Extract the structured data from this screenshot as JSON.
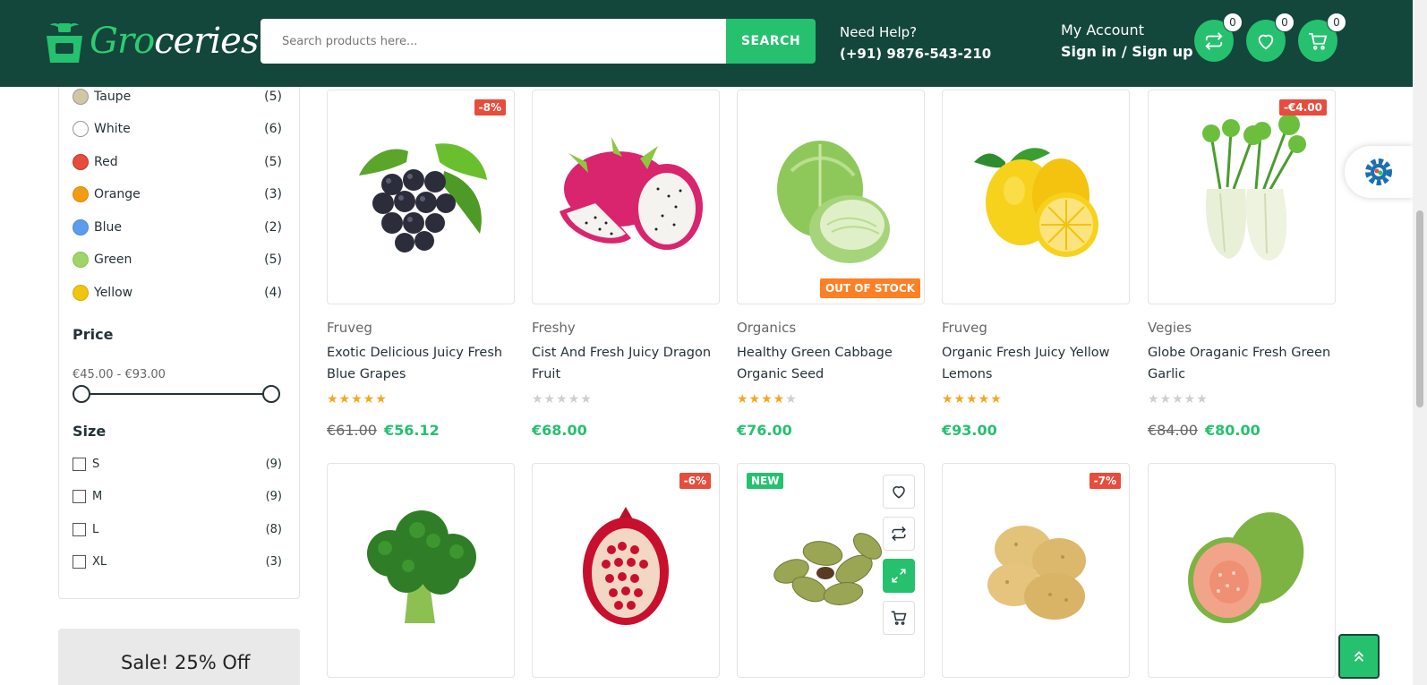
{
  "header": {
    "logo_text_a": "Gro",
    "logo_text_b": "ceries",
    "search_placeholder": "Search products here...",
    "search_button": "SEARCH",
    "help_title": "Need Help?",
    "help_phone": "(+91) 9876-543-210",
    "account_title": "My Account",
    "account_link": "Sign in / Sign up",
    "compare_count": "0",
    "wishlist_count": "0",
    "cart_count": "0"
  },
  "sidebar": {
    "colors": [
      {
        "label": "Taupe",
        "count": "(5)",
        "hex": "#d1c6a6"
      },
      {
        "label": "White",
        "count": "(6)",
        "hex": "#ffffff"
      },
      {
        "label": "Red",
        "count": "(5)",
        "hex": "#e84c3d"
      },
      {
        "label": "Orange",
        "count": "(3)",
        "hex": "#f39c11"
      },
      {
        "label": "Blue",
        "count": "(2)",
        "hex": "#5d9cec"
      },
      {
        "label": "Green",
        "count": "(5)",
        "hex": "#a0d468"
      },
      {
        "label": "Yellow",
        "count": "(4)",
        "hex": "#f1c40f"
      }
    ],
    "price_title": "Price",
    "price_range": "€45.00 - €93.00",
    "size_title": "Size",
    "sizes": [
      {
        "label": "S",
        "count": "(9)"
      },
      {
        "label": "M",
        "count": "(9)"
      },
      {
        "label": "L",
        "count": "(8)"
      },
      {
        "label": "XL",
        "count": "(3)"
      }
    ],
    "banner_text": "Sale! 25% Off"
  },
  "products": [
    {
      "brand": "Fruveg",
      "name": "Exotic Delicious Juicy Fresh Blue Grapes",
      "rating": 5,
      "old_price": "€61.00",
      "price": "€56.12",
      "badge": "-8%"
    },
    {
      "brand": "Freshy",
      "name": "Cist And Fresh Juicy Dragon Fruit",
      "rating": 0,
      "old_price": "",
      "price": "€68.00",
      "badge": ""
    },
    {
      "brand": "Organics",
      "name": "Healthy Green Cabbage Organic Seed",
      "rating": 4,
      "old_price": "",
      "price": "€76.00",
      "badge": "",
      "stock": "OUT OF STOCK"
    },
    {
      "brand": "Fruveg",
      "name": "Organic Fresh Juicy Yellow Lemons",
      "rating": 5,
      "old_price": "",
      "price": "€93.00",
      "badge": ""
    },
    {
      "brand": "Vegies",
      "name": "Globe Oraganic Fresh Green Garlic",
      "rating": 0,
      "old_price": "€84.00",
      "price": "€80.00",
      "badge": "-€4.00"
    }
  ],
  "products_row2": [
    {
      "badge": ""
    },
    {
      "badge": "-6%"
    },
    {
      "badge": "NEW"
    },
    {
      "badge": "-7%"
    },
    {
      "badge": ""
    }
  ],
  "icons": {
    "compare": "compare-icon",
    "wishlist": "heart-icon",
    "cart": "cart-icon",
    "settings": "gear-icon",
    "scroll_top": "chevron-up-icon"
  },
  "colors": {
    "header": "#14473c",
    "accent": "#25c16f",
    "sale": "#e74c3c",
    "stock": "#ff7f24"
  }
}
